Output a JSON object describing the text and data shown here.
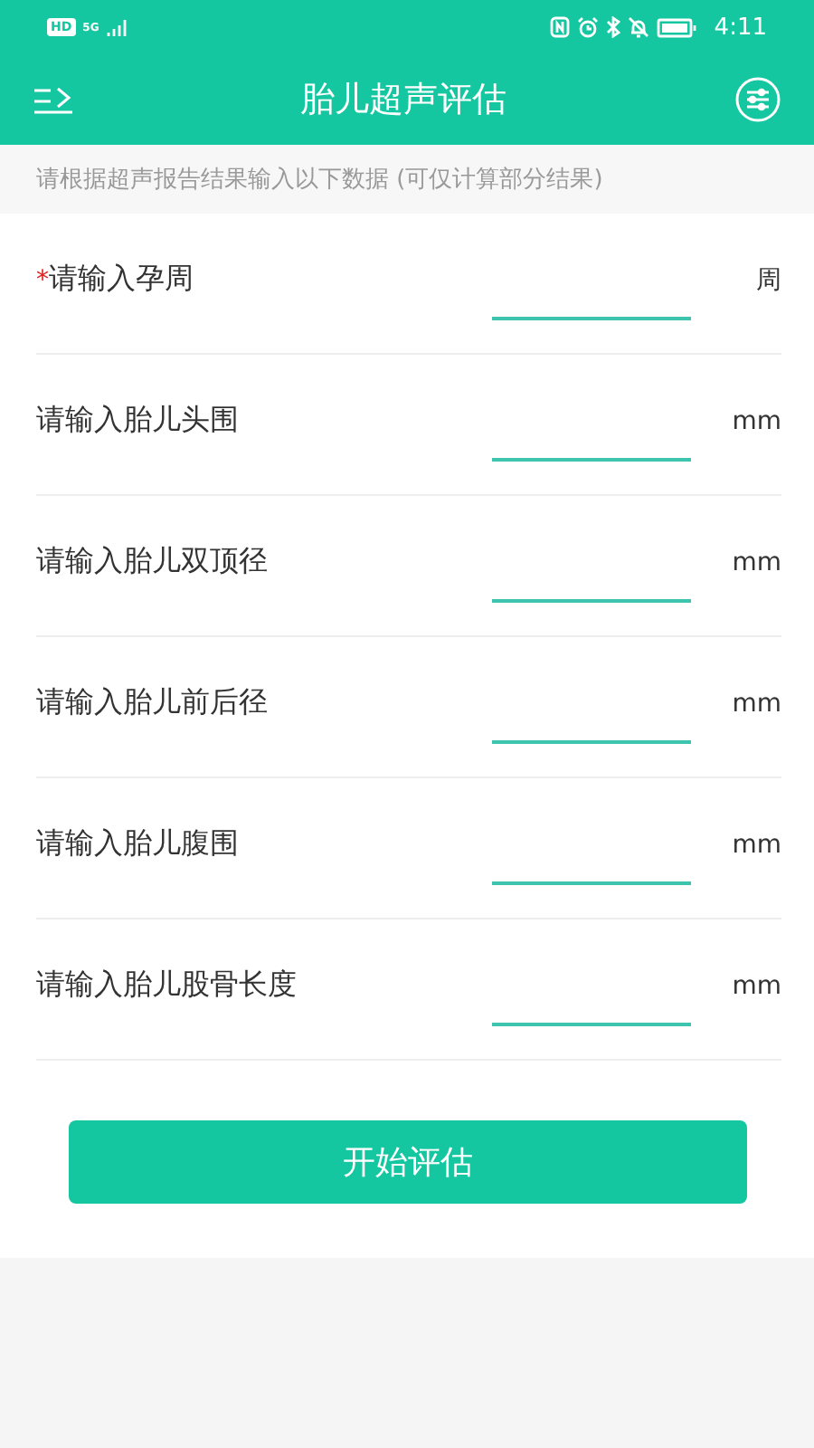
{
  "status_bar": {
    "network_badge": "HD",
    "network_type": "5G",
    "time": "4:11"
  },
  "header": {
    "title": "胎儿超声评估"
  },
  "notice": "请根据超声报告结果输入以下数据 (可仅计算部分结果)",
  "fields": [
    {
      "required_mark": "*",
      "label": "请输入孕周",
      "unit": "周"
    },
    {
      "label": "请输入胎儿头围",
      "unit": "mm"
    },
    {
      "label": "请输入胎儿双顶径",
      "unit": "mm"
    },
    {
      "label": "请输入胎儿前后径",
      "unit": "mm"
    },
    {
      "label": "请输入胎儿腹围",
      "unit": "mm"
    },
    {
      "label": "请输入胎儿股骨长度",
      "unit": "mm"
    }
  ],
  "submit_button": "开始评估"
}
